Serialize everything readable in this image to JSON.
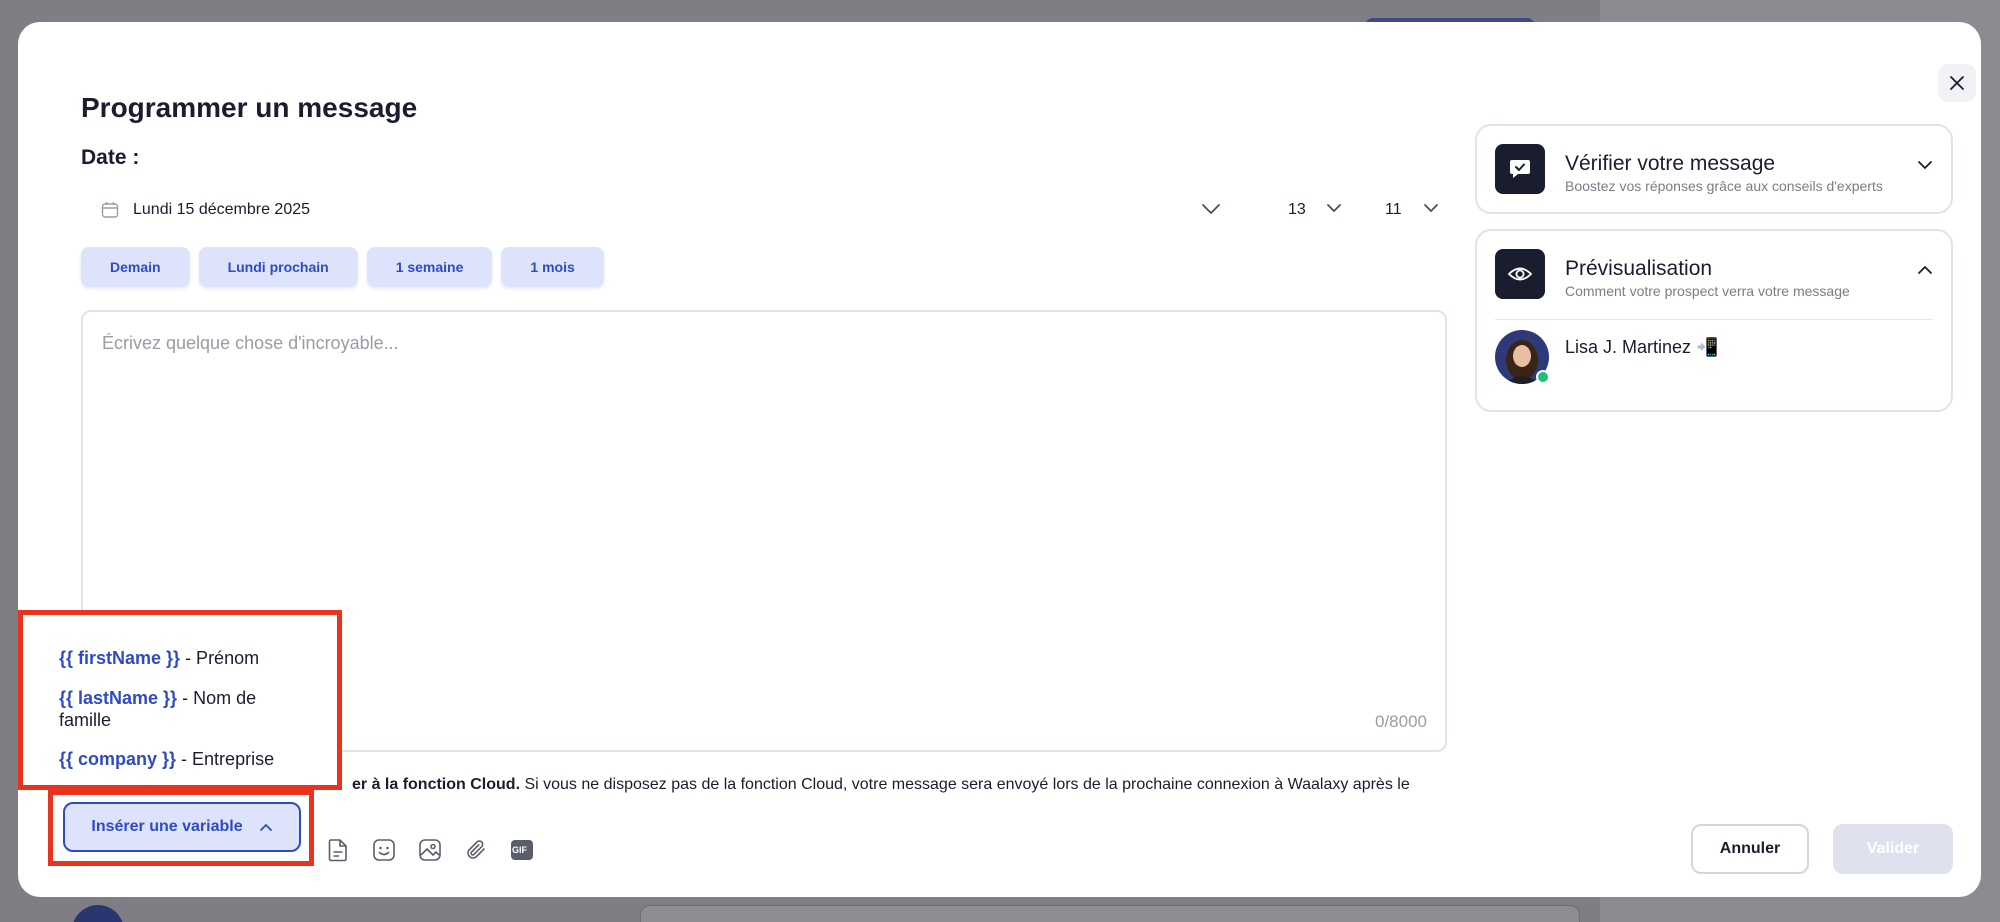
{
  "modal": {
    "title": "Programmer un message",
    "date_label": "Date :"
  },
  "schedule": {
    "date_value": "Lundi 15 décembre 2025",
    "hour": "13",
    "minute": "11",
    "quick_options": [
      "Demain",
      "Lundi prochain",
      "1 semaine",
      "1 mois"
    ]
  },
  "editor": {
    "placeholder": "Écrivez quelque chose d'incroyable...",
    "counter": "0/8000"
  },
  "cloud_note": {
    "bold": "er à la fonction Cloud.",
    "rest": " Si vous ne disposez pas de la fonction Cloud, votre message sera envoyé lors de la prochaine connexion à Waalaxy après le"
  },
  "variables_menu": {
    "items": [
      {
        "var": "{{ firstName }}",
        "desc": " - Prénom"
      },
      {
        "var": "{{ lastName }}",
        "desc": " - Nom de famille"
      },
      {
        "var": "{{ company }}",
        "desc": " - Entreprise"
      }
    ]
  },
  "toolbar": {
    "insert_variable_label": "Insérer une variable",
    "gif_label": "GIF",
    "icons": [
      "template-icon",
      "emoji-icon",
      "image-icon",
      "attachment-icon",
      "gif-icon"
    ]
  },
  "footer": {
    "cancel_label": "Annuler",
    "validate_label": "Valider"
  },
  "verify_panel": {
    "title": "Vérifier votre message",
    "subtitle": "Boostez vos réponses grâce aux conseils d'experts"
  },
  "preview_panel": {
    "title": "Prévisualisation",
    "subtitle": "Comment votre prospect verra votre message",
    "contact_name": "Lisa J. Martinez",
    "contact_emoji": "📲"
  },
  "colors": {
    "accent": "#2f4bc4",
    "accent_light": "#dde3fb",
    "highlight": "#e8341c",
    "online": "#1fbf7a"
  }
}
